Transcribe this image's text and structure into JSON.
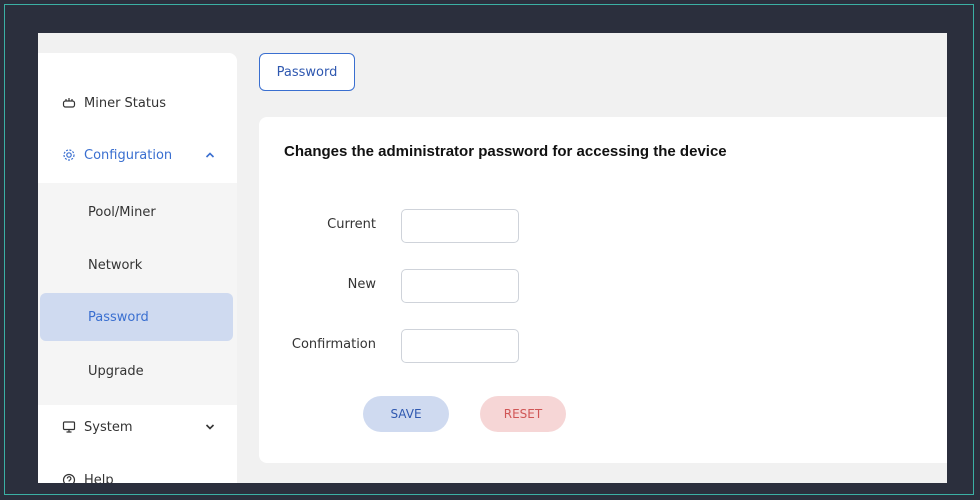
{
  "sidebar": {
    "items": [
      {
        "label": "Miner Status",
        "icon": "router-icon"
      },
      {
        "label": "Configuration",
        "icon": "gear-icon",
        "expanded": true
      },
      {
        "label": "System",
        "icon": "monitor-icon",
        "expanded": false
      },
      {
        "label": "Help",
        "icon": "help-icon"
      }
    ],
    "sub_items": [
      "Pool/Miner",
      "Network",
      "Password",
      "Upgrade"
    ],
    "selected_sub": "Password"
  },
  "tab": {
    "label": "Password"
  },
  "card": {
    "title": "Changes the administrator password for accessing the device",
    "fields": [
      {
        "label": "Current",
        "value": ""
      },
      {
        "label": "New",
        "value": ""
      },
      {
        "label": "Confirmation",
        "value": ""
      }
    ],
    "save_label": "SAVE",
    "reset_label": "RESET"
  },
  "colors": {
    "accent": "#3a6fd0",
    "selected_bg": "#cfdaf0",
    "reset_bg": "#f6d6d6",
    "reset_text": "#d05656",
    "frame_bg": "#2b2f3d",
    "frame_border": "#3bb0a4"
  }
}
